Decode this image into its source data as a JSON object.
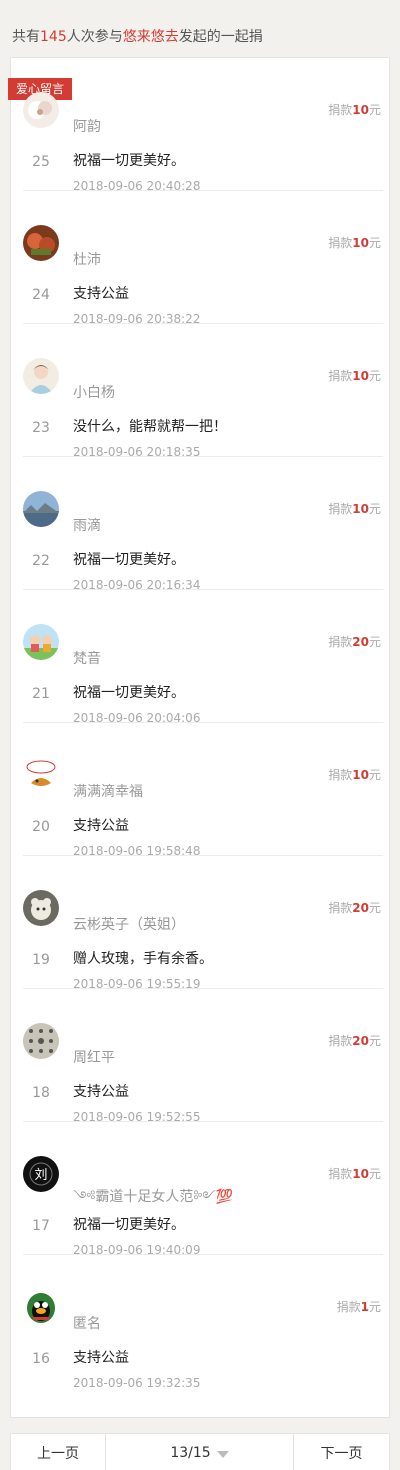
{
  "summary": {
    "prefix": "共有",
    "count": "145",
    "middle": "人次参与",
    "initiator": "悠来悠去",
    "suffix": "发起的一起捐"
  },
  "tag_label": "爱心留言",
  "amount_prefix": "捐款",
  "amount_unit": "元",
  "donations": [
    {
      "rank": "25",
      "name": "阿韵",
      "message": "祝福一切更美好。",
      "time": "2018-09-06 20:40:28",
      "amount": "10",
      "avatar": "flower-avatar-icon"
    },
    {
      "rank": "24",
      "name": "杜沛",
      "message": "支持公益",
      "time": "2018-09-06 20:38:22",
      "amount": "10",
      "avatar": "fruit-avatar-icon"
    },
    {
      "rank": "23",
      "name": "小白杨",
      "message": "没什么，能帮就帮一把！",
      "time": "2018-09-06 20:18:35",
      "amount": "10",
      "avatar": "girl-avatar-icon"
    },
    {
      "rank": "22",
      "name": "雨滴",
      "message": "祝福一切更美好。",
      "time": "2018-09-06 20:16:34",
      "amount": "10",
      "avatar": "landscape-avatar-icon"
    },
    {
      "rank": "21",
      "name": "梵音",
      "message": "祝福一切更美好。",
      "time": "2018-09-06 20:04:06",
      "amount": "20",
      "avatar": "cartoon-avatar-icon"
    },
    {
      "rank": "20",
      "name": "满满滴幸福",
      "message": "支持公益",
      "time": "2018-09-06 19:58:48",
      "amount": "10",
      "avatar": "sticker-avatar-icon"
    },
    {
      "rank": "19",
      "name": "云彬英子（英姐）",
      "message": "赠人玫瑰，手有余香。",
      "time": "2018-09-06 19:55:19",
      "amount": "20",
      "avatar": "pet-avatar-icon"
    },
    {
      "rank": "18",
      "name": "周红平",
      "message": "支持公益",
      "time": "2018-09-06 19:52:55",
      "amount": "20",
      "avatar": "pattern-avatar-icon"
    },
    {
      "rank": "17",
      "name": "༺霸道十足女人范༻💯",
      "message": "祝福一切更美好。",
      "time": "2018-09-06 19:40:09",
      "amount": "10",
      "avatar": "calligraphy-avatar-icon"
    },
    {
      "rank": "16",
      "name": "匿名",
      "message": "支持公益",
      "time": "2018-09-06 19:32:35",
      "amount": "1",
      "avatar": "penguin-avatar-icon"
    }
  ],
  "pager": {
    "prev_label": "上一页",
    "current": "13/15",
    "next_label": "下一页"
  }
}
